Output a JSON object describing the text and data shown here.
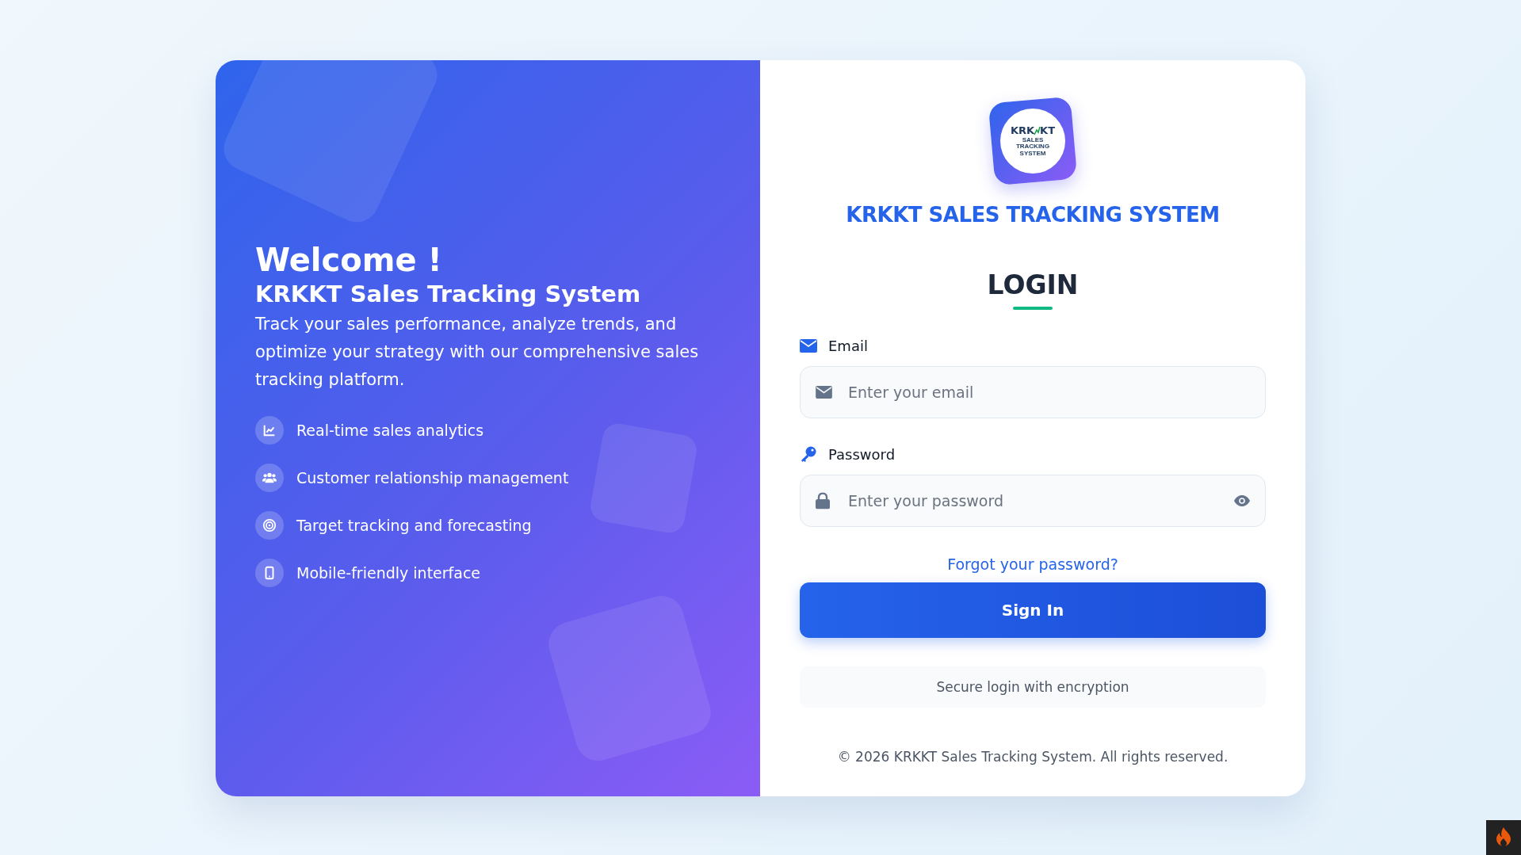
{
  "welcome": {
    "heading": "Welcome !",
    "subtitle": "KRKKT Sales Tracking System",
    "description": "Track your sales performance, analyze trends, and optimize your strategy with our comprehensive sales tracking platform."
  },
  "features": [
    {
      "kind": "chart",
      "label": "Real-time sales analytics"
    },
    {
      "kind": "users",
      "label": "Customer relationship management"
    },
    {
      "kind": "target",
      "label": "Target tracking and forecasting"
    },
    {
      "kind": "mobile",
      "label": "Mobile-friendly interface"
    }
  ],
  "logo": {
    "wordmark_start": "KRK",
    "wordmark_end": "KT",
    "tagline": "SALES TRACKING SYSTEM"
  },
  "app_title": "KRKKT SALES TRACKING SYSTEM",
  "form": {
    "title": "LOGIN",
    "fields": [
      {
        "kind": "email",
        "label": "Email",
        "placeholder": "Enter your email"
      },
      {
        "kind": "password",
        "label": "Password",
        "placeholder": "Enter your password"
      }
    ],
    "forgot_link": "Forgot your password?",
    "submit": "Sign In",
    "secure_note": "Secure login with encryption"
  },
  "footer": "© 2026 KRKKT Sales Tracking System. All rights reserved."
}
